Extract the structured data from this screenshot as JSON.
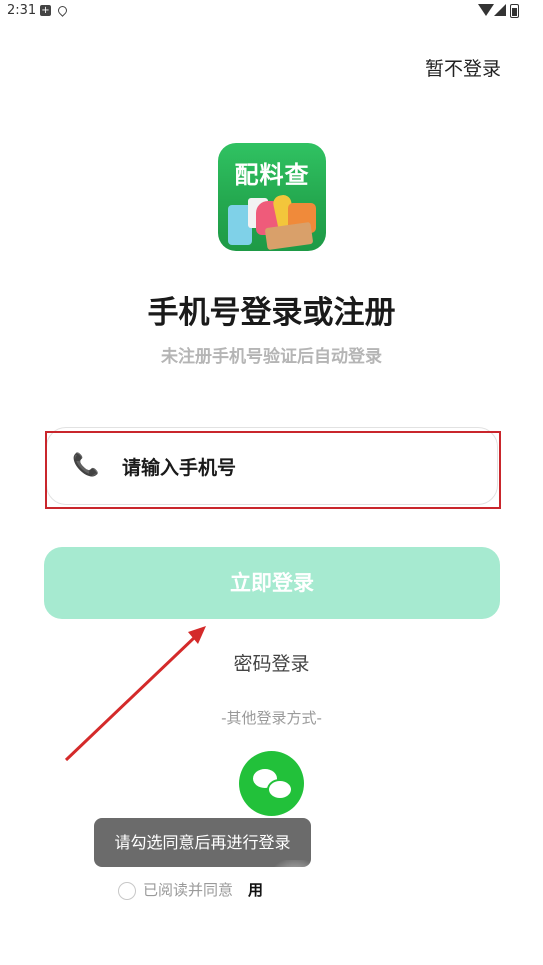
{
  "status_bar": {
    "time": "2:31"
  },
  "header": {
    "skip_login": "暂不登录"
  },
  "logo": {
    "text": "配料查"
  },
  "title": "手机号登录或注册",
  "subtitle": "未注册手机号验证后自动登录",
  "phone_field": {
    "placeholder": "请输入手机号",
    "icon": "phone-icon"
  },
  "login_button": "立即登录",
  "password_login": "密码登录",
  "other_methods": "-其他登录方式-",
  "toast": "请勾选同意后再进行登录",
  "agreement": {
    "text": "已阅读并同意",
    "link": "用"
  },
  "colors": {
    "login_button_bg": "#a6ead0",
    "wechat_green": "#22c13a",
    "annotation_red": "#c9262c"
  }
}
